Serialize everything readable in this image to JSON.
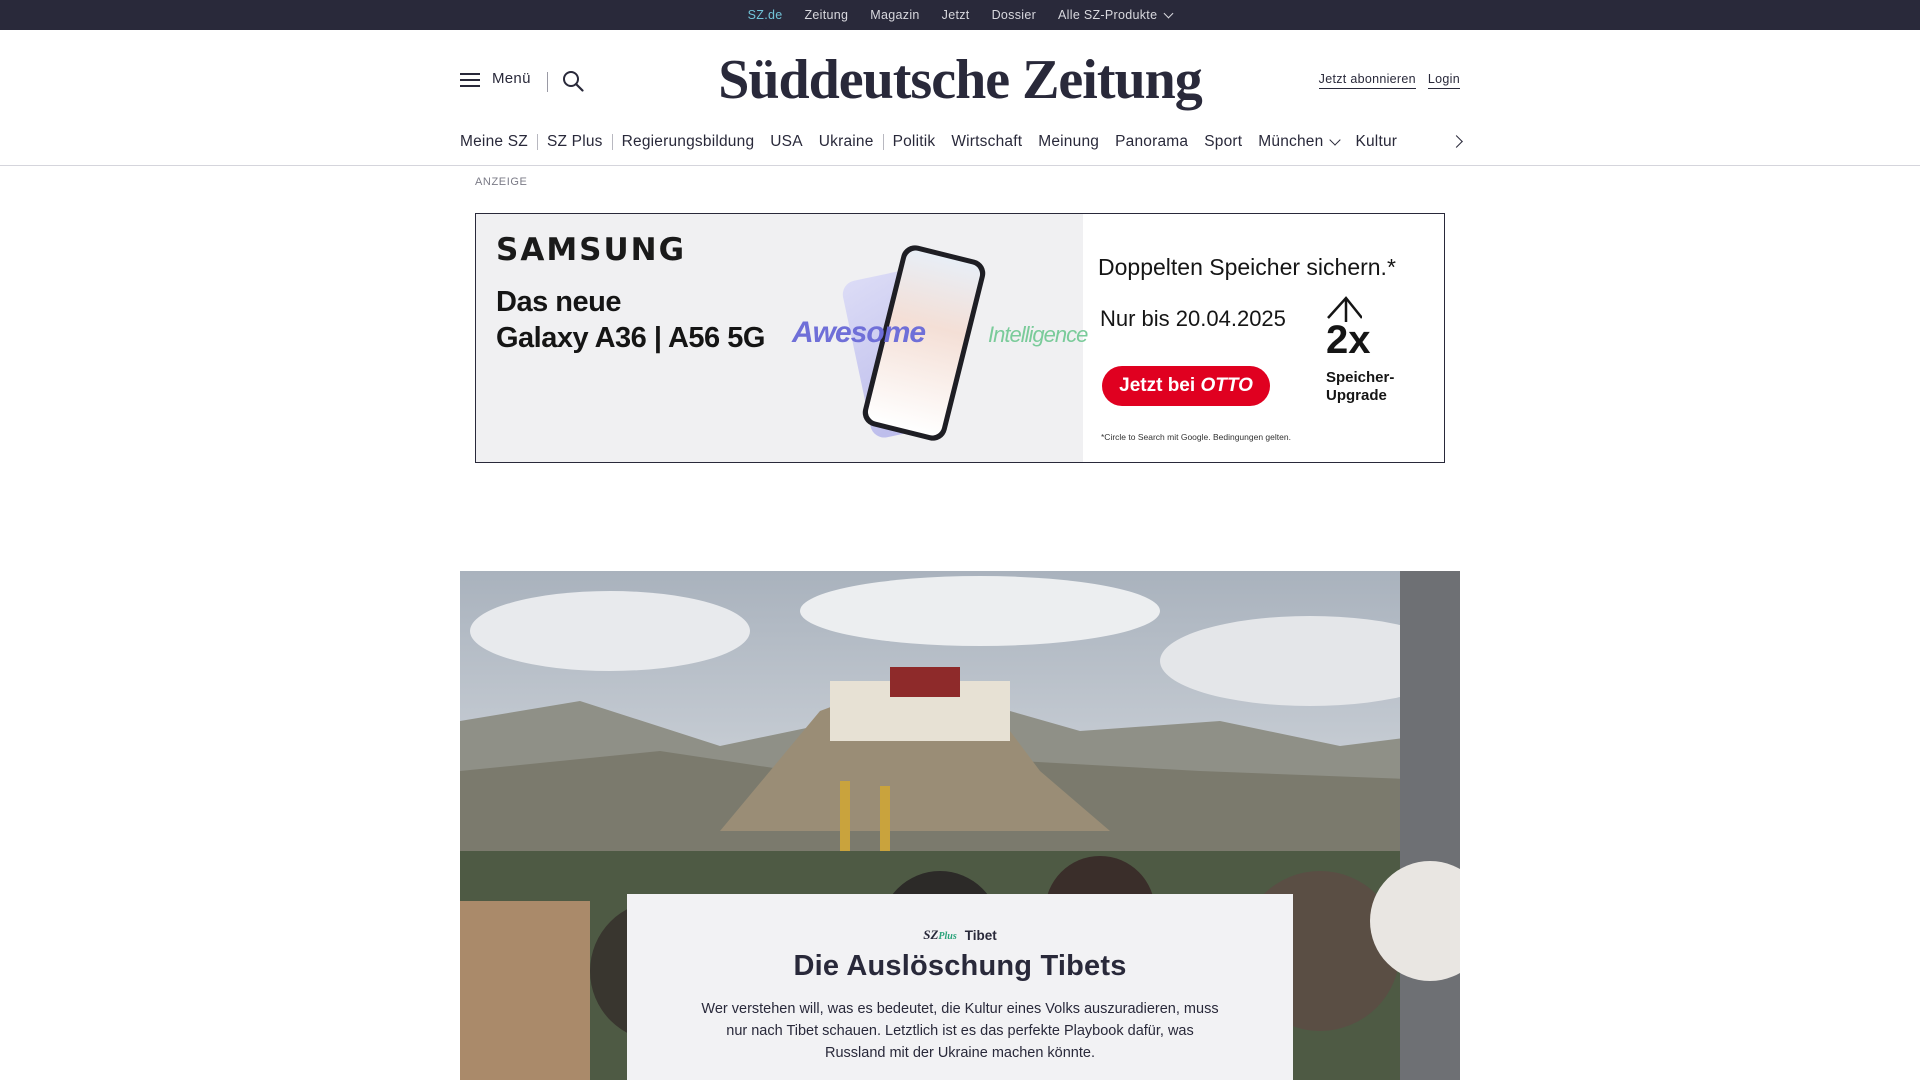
{
  "topbar": {
    "links": [
      "SZ.de",
      "Zeitung",
      "Magazin",
      "Jetzt",
      "Dossier"
    ],
    "products_label": "Alle SZ-Produkte"
  },
  "masthead": {
    "menu_label": "Menü",
    "logo": "Süddeutsche Zeitung",
    "subscribe_label": "Jetzt abonnieren",
    "login_label": "Login"
  },
  "nav": {
    "items": [
      "Meine SZ",
      "SZ Plus",
      "Regierungsbildung",
      "USA",
      "Ukraine",
      "Politik",
      "Wirtschaft",
      "Meinung",
      "Panorama",
      "Sport",
      "München",
      "Kultur"
    ]
  },
  "ad": {
    "label": "ANZEIGE",
    "brand": "SAMSUNG",
    "headline_line1": "Das neue",
    "headline_line2": "Galaxy A36 | A56 5G",
    "awesome": "Awesome",
    "intelligence": "Intelligence",
    "offer": "Doppelten Speicher sichern.*",
    "date": "Nur bis 20.04.2025",
    "cta_prefix": "Jetzt bei",
    "cta_brand": "OTTO",
    "multiplier": "2x",
    "upgrade_line1": "Speicher-",
    "upgrade_line2": "Upgrade",
    "fine_print": "*Circle to Search mit Google. Bedingungen gelten."
  },
  "teaser": {
    "badge_sz": "SZ",
    "badge_plus": "Plus",
    "kicker": "Tibet",
    "title": "Die Auslöschung Tibets",
    "text": "Wer verstehen will, was es bedeutet, die Kultur eines Volks auszuradieren, muss nur nach Tibet schauen. Letztlich ist es das perfekte Playbook dafür, was Russland mit der Ukraine machen könnte."
  },
  "colors": {
    "navy": "#29293a",
    "active_link": "#71c3d8",
    "szplus_green": "#2aa37a",
    "ad_cta_red": "#e00020"
  }
}
